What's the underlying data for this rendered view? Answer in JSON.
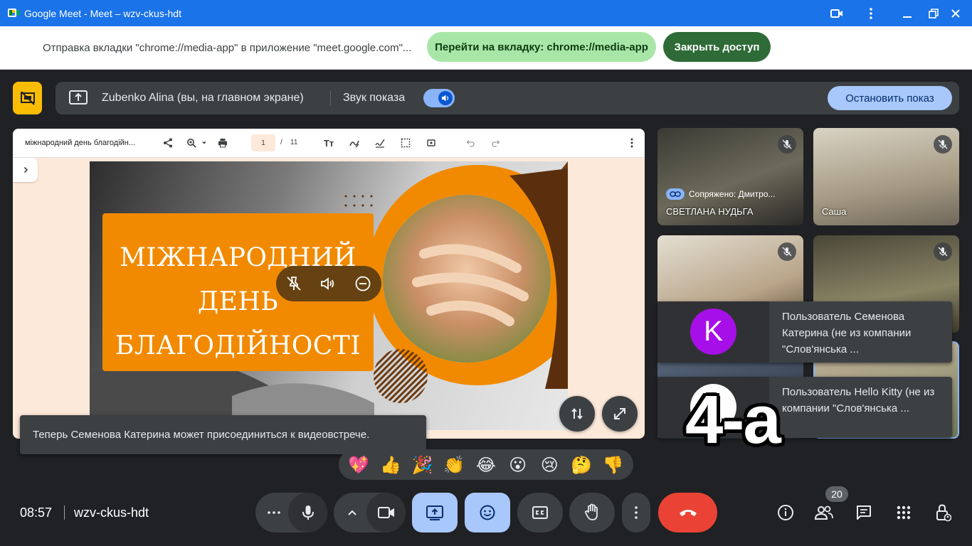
{
  "window": {
    "title": "Google Meet - Meet – wzv-ckus-hdt",
    "icons": [
      "meet-logo-icon",
      "camera-icon",
      "kebab-menu-icon",
      "minimize-icon",
      "restore-icon",
      "close-icon"
    ]
  },
  "share_notice": {
    "message": "Отправка вкладки \"chrome://media-app\" в приложение \"meet.google.com\"...",
    "goto_tab_label": "Перейти на вкладку: chrome://media-app",
    "close_access_label": "Закрыть доступ"
  },
  "presenting": {
    "presenter_label": "Zubenko Alina (вы, на главном экране)",
    "sound_label": "Звук показа",
    "sound_on": true,
    "stop_label": "Остановить показ"
  },
  "viewer": {
    "doc_name": "міжнародний день благодійн...",
    "page_current": "1",
    "page_separator": "/",
    "page_total": "11",
    "text_tool_label": "Tт"
  },
  "slide": {
    "title_lines": [
      "МІЖНАРОДНИЙ",
      "ДЕНЬ",
      "БЛАГОДІЙНОСТІ"
    ],
    "accent": "#f18a00"
  },
  "toast": {
    "message": "Теперь Семенова Катерина может присоединиться к видеовстрече."
  },
  "tiles": [
    {
      "name": "СВЕТЛАНА НУДЬГА",
      "paired": "Сопряжено: Дмитро...",
      "muted": true
    },
    {
      "name": "Саша",
      "muted": true
    },
    {
      "name": "",
      "muted": true
    },
    {
      "name": "",
      "muted": true
    },
    {
      "name": "",
      "muted": false
    },
    {
      "name": "",
      "muted": false
    }
  ],
  "join_requests": [
    {
      "avatar_letter": "K",
      "avatar_color": "#a70fe8",
      "text": "Пользователь Семенова Катерина (не из компании \"Слов'янська ..."
    },
    {
      "avatar_letter": "",
      "avatar_color": "#ffffff",
      "text": "Пользователь Hello Kitty (не из компании \"Слов'янська ..."
    }
  ],
  "sticker_text": "4-а",
  "reactions": [
    "💖",
    "👍",
    "🎉",
    "👏",
    "😂",
    "😮",
    "😢",
    "🤔",
    "👎"
  ],
  "bottom": {
    "time": "08:57",
    "meeting_code": "wzv-ckus-hdt",
    "people_count": "20",
    "end_call_color": "#ea4335"
  }
}
